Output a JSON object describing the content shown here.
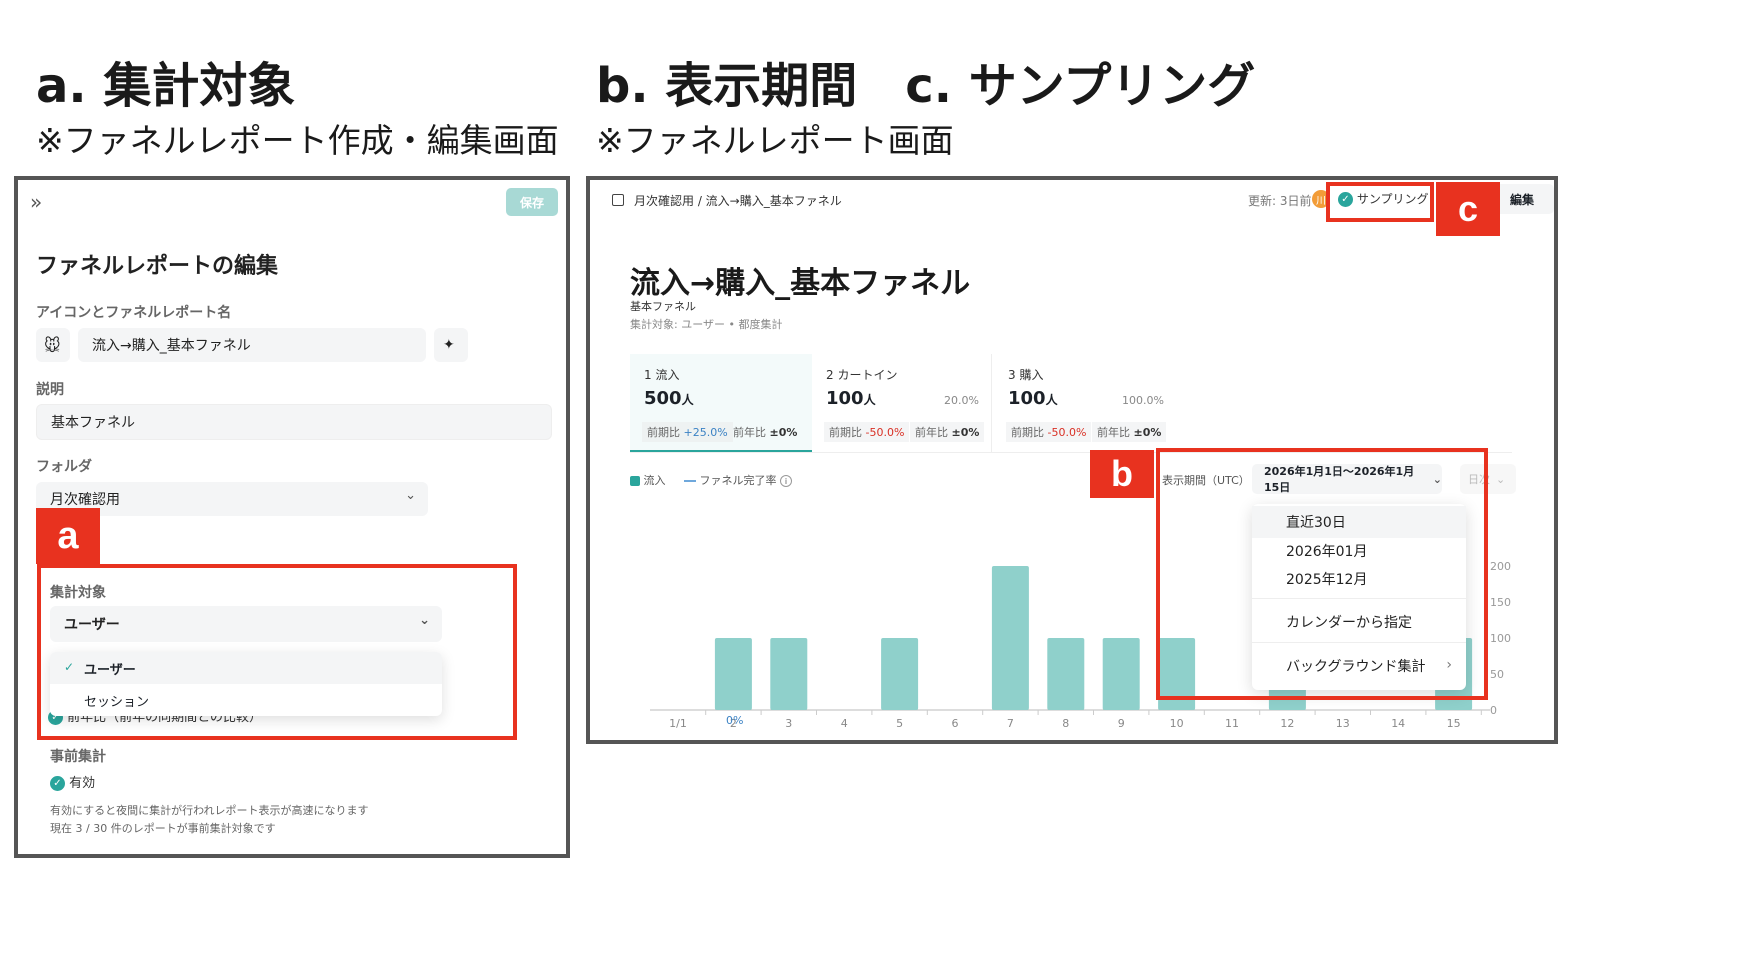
{
  "heading_a": "a.  集計対象",
  "heading_b": "b. 表示期間　c. サンプリング",
  "sub_a": "※ファネルレポート作成・編集画面",
  "sub_b": "※ファネルレポート画面",
  "editor": {
    "expand_icon": "»",
    "save_label": "保存",
    "title": "ファネルレポートの編集",
    "name_label": "アイコンとファネルレポート名",
    "icon_emoji": "🐭",
    "name_value": "流入→購入_基本ファネル",
    "sparkle_icon": "✦",
    "desc_label": "説明",
    "desc_value": "基本ファネル",
    "folder_label": "フォルダ",
    "folder_value": "月次確認用",
    "target_label": "集計対象",
    "target_value": "ユーザー",
    "target_options": [
      "ユーザー",
      "セッション"
    ],
    "compare_label": "前年比（前年の同期間との比較）",
    "precalc_label": "事前集計",
    "precalc_value": "有効",
    "note1": "有効にすると夜間に集計が行われレポート表示が高速になります",
    "note2": "現在 3 / 30 件のレポートが事前集計対象です"
  },
  "report": {
    "breadcrumb": "月次確認用 / 流入→購入_基本ファネル",
    "updated": "更新: 3日前",
    "avatar": "川",
    "sampling_label": "サンプリング",
    "edit_label": "編集",
    "title": "流入→購入_基本ファネル",
    "subtitle": "基本ファネル",
    "meta": "集計対象: ユーザー • 都度集計",
    "steps": [
      {
        "label": "1 流入",
        "value": "500",
        "unit": "人",
        "pct": "",
        "prev_label": "前期比",
        "prev": "+25.0%",
        "yoy_label": "前年比",
        "yoy": "±0%"
      },
      {
        "label": "2 カートイン",
        "value": "100",
        "unit": "人",
        "pct": "20.0%",
        "prev_label": "前期比",
        "prev": "-50.0%",
        "yoy_label": "前年比",
        "yoy": "±0%"
      },
      {
        "label": "3 購入",
        "value": "100",
        "unit": "人",
        "pct": "100.0%",
        "prev_label": "前期比",
        "prev": "-50.0%",
        "yoy_label": "前年比",
        "yoy": "±0%"
      }
    ],
    "legend_inflow": "流入",
    "legend_rate": "ファネル完了率",
    "period_label": "表示期間（UTC）",
    "period_value": "2026年1月1日〜2026年1月15日",
    "granularity": "日次",
    "menu": [
      "直近30日",
      "2026年01月",
      "2025年12月",
      "カレンダーから指定",
      "バックグラウンド集計"
    ],
    "zero_label": "0%"
  },
  "tags": {
    "a": "a",
    "b": "b",
    "c": "c"
  },
  "colors": {
    "accent": "#2aa59c",
    "bar": "#8fd0cb",
    "red": "#e8321f",
    "up": "#3b82c4",
    "down": "#d93025"
  },
  "chart_data": {
    "type": "bar",
    "categories": [
      "1/1",
      "2",
      "3",
      "4",
      "5",
      "6",
      "7",
      "8",
      "9",
      "10",
      "11",
      "12",
      "13",
      "14",
      "15"
    ],
    "series": [
      {
        "name": "流入",
        "values": [
          0,
          100,
          100,
          0,
          100,
          0,
          200,
          100,
          100,
          100,
          0,
          100,
          0,
          0,
          100
        ]
      }
    ],
    "yticks": [
      0,
      50,
      100,
      150,
      200
    ],
    "ylim": [
      0,
      200
    ]
  }
}
